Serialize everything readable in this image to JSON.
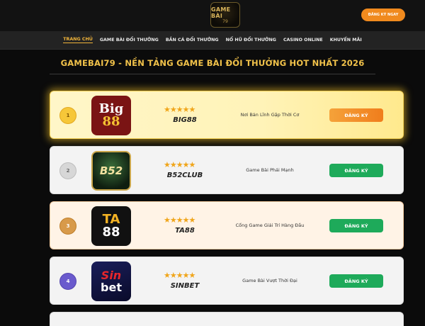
{
  "header": {
    "logo_text": "GAME BÀI",
    "logo_sub": "79",
    "cta_label": "ĐĂNG KÝ NGAY"
  },
  "nav": {
    "items": [
      {
        "label": "TRANG CHỦ",
        "active": true
      },
      {
        "label": "GAME BÀI ĐỔI THƯỞNG"
      },
      {
        "label": "BẮN CÁ ĐỔI THƯỞNG"
      },
      {
        "label": "NỔ HŨ ĐỔI THƯỞNG"
      },
      {
        "label": "CASINO ONLINE"
      },
      {
        "label": "KHUYẾN MÃI"
      }
    ]
  },
  "hero": {
    "title": "GAMEBAI79 - NỀN TẢNG GAME BÀI ĐỔI THƯỞNG HOT NHẤT 2026"
  },
  "ranking": [
    {
      "rank": "1",
      "brand": "BIG88",
      "logo_line1": "Big",
      "logo_line2": "88",
      "stars": "★★★★★",
      "tagline": "Nơi Bản Lĩnh Gặp Thời Cơ",
      "button": "ĐĂNG KÝ"
    },
    {
      "rank": "2",
      "brand": "B52CLUB",
      "logo_line1": "B52",
      "logo_line2": "",
      "stars": "★★★★★",
      "tagline": "Game Bài Phái Mạnh",
      "button": "ĐĂNG KÝ"
    },
    {
      "rank": "3",
      "brand": "TA88",
      "logo_line1": "TA",
      "logo_line2": "88",
      "stars": "★★★★★",
      "tagline": "Cổng Game Giải Trí Hàng Đầu",
      "button": "ĐĂNG KÝ"
    },
    {
      "rank": "4",
      "brand": "SINBET",
      "logo_line1": "Sin",
      "logo_line2": "bet",
      "stars": "★★★★★",
      "tagline": "Game Bài Vượt Thời Đại",
      "button": "ĐĂNG KÝ"
    }
  ],
  "colors": {
    "accent_gold": "#f1c24a",
    "button_orange": "#f07d1c",
    "button_green": "#1eaa5a"
  }
}
